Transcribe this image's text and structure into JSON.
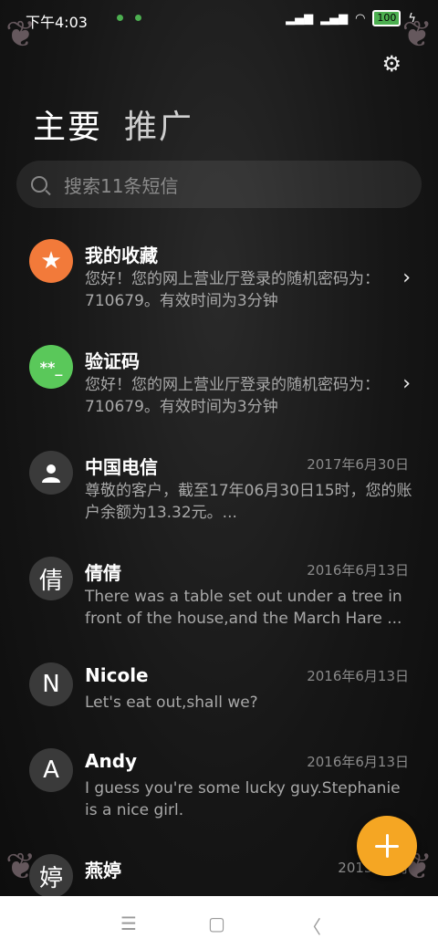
{
  "status": {
    "time": "下午4:03",
    "battery": "100"
  },
  "tabs": [
    {
      "label": "主要"
    },
    {
      "label": "推广"
    }
  ],
  "search": {
    "placeholder": "搜索11条短信"
  },
  "conversations": [
    {
      "avatar": "★",
      "avatar_color": "#f27a3a",
      "title": "我的收藏",
      "date": "",
      "preview": "您好！您的网上营业厅登录的随机密码为：710679。有效时间为3分钟",
      "chevron": true
    },
    {
      "avatar": "**_",
      "avatar_color": "#5ac85a",
      "title": "验证码",
      "date": "",
      "preview": "您好！您的网上营业厅登录的随机密码为：710679。有效时间为3分钟",
      "chevron": true
    },
    {
      "avatar": "",
      "avatar_color": "#3a3a3a",
      "title": "中国电信",
      "date": "2017年6月30日",
      "preview": "尊敬的客户，截至17年06月30日15时，您的账户余额为13.32元。...",
      "chevron": false
    },
    {
      "avatar": "倩",
      "avatar_color": "#3a3a3a",
      "title": "倩倩",
      "date": "2016年6月13日",
      "preview": "There was a table set out under a tree in front of the house,and the March Hare ...",
      "chevron": false
    },
    {
      "avatar": "N",
      "avatar_color": "#3a3a3a",
      "title": "Nicole",
      "date": "2016年6月13日",
      "preview": "Let's eat out,shall we?",
      "chevron": false
    },
    {
      "avatar": "A",
      "avatar_color": "#3a3a3a",
      "title": "Andy",
      "date": "2016年6月13日",
      "preview": "I guess you're some lucky guy.Stephanie is a nice girl.",
      "chevron": false
    },
    {
      "avatar": "婷",
      "avatar_color": "#3a3a3a",
      "title": "燕婷",
      "date": "2013年2月",
      "preview": "",
      "chevron": false
    }
  ],
  "nav": {
    "menu": "☰",
    "home": "▢",
    "back": "〈"
  }
}
